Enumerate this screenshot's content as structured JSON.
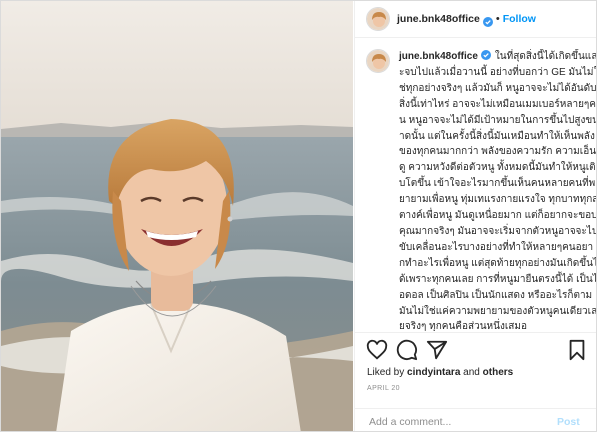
{
  "post": {
    "username": "june.bnk48office",
    "follow_label": "Follow",
    "dot": "•",
    "caption": "ในที่สุดสิ่งนี้ได้เกิดขึ้นและจบไปแล้วเมื่อวานนี้ อย่างที่บอกว่า GE มันไม่ใช่ทุกอย่างจริงๆ แล้วมันก็ หนูอาจจะไม่ได้อันดับสิ่งนี้เท่าไหร่ อาจจะไม่เหมือนเมมเบอร์หลายๆคน หนูอาจจะไม่ได้มีเป้าหมายในการขึ้นไปสูงขนาดนั้น แต่ในครั้งนี้สิ่งนี้มันเหมือนทำให้เห็นพลังของทุกคนมากกว่า พลังของความรัก ความเอ็นดู ความหวังดีต่อตัวหนู ทั้งหมดนี้มันทำให้หนูเติบโตขึ้น เข้าใจอะไรมากขึ้นเห็นคนหลายคนที่พยายามเพื่อหนู ทุ่มเทแรงกายแรงใจ ทุกบาททุกสตางค์เพื่อหนู มันดูเหนื่อยมาก แต่ก็อยากจะขอบคุณมากจริงๆ มันอาจจะเริ่มจากตัวหนูอาจจะไปขับเคลื่อนอะไรบางอย่างที่ทำให้หลายๆคนอยากทำอะไรเพื่อหนู แต่สุดท้ายทุกอย่างมันเกิดขึ้นได้เพราะทุกคนเลย การที่หนูมายืนตรงนี้ได้ เป็นไอดอล เป็นศิลปิน เป็นนักแสดง หรืออะไรก็ตาม มันไม่ใช่แค่ความพยายามของตัวหนูคนเดียวเลยจริงๆ ทุกคนคือส่วนหนึ่งเสมอ",
    "liked_prefix": "Liked by ",
    "liked_user": "cindyintara",
    "liked_mid": " and ",
    "liked_others": "others",
    "date": "APRIL 20",
    "add_comment_placeholder": "Add a comment...",
    "post_label": "Post"
  },
  "icons": [
    "heart-icon",
    "comment-icon",
    "share-icon",
    "bookmark-icon",
    "verified-badge-icon"
  ],
  "colors": {
    "link_blue": "#0095f6",
    "post_disabled": "#b2dffc",
    "muted": "#8e8e8e"
  }
}
